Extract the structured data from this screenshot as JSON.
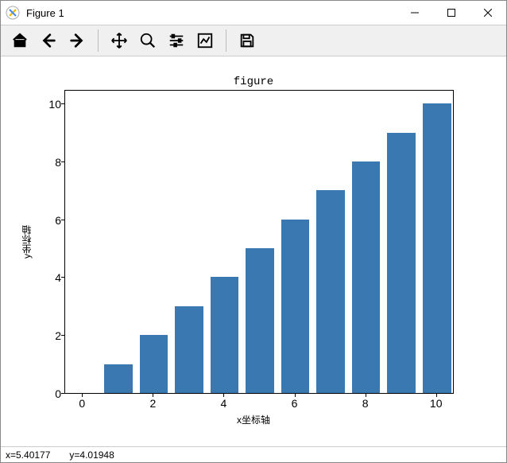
{
  "window": {
    "title": "Figure 1"
  },
  "toolbar": {
    "home": "home-icon",
    "back": "back-icon",
    "forward": "forward-icon",
    "pan": "pan-icon",
    "zoom": "zoom-icon",
    "config": "sliders-icon",
    "edit": "line-chart-icon",
    "save": "save-icon"
  },
  "statusbar": {
    "x": "x=5.40177",
    "y": "y=4.01948"
  },
  "chart_data": {
    "type": "bar",
    "title": "figure",
    "xlabel": "x坐标轴",
    "ylabel": "y坐标轴",
    "categories": [
      1,
      2,
      3,
      4,
      5,
      6,
      7,
      8,
      9,
      10
    ],
    "values": [
      1,
      2,
      3,
      4,
      5,
      6,
      7,
      8,
      9,
      10
    ],
    "xlim": [
      -0.5,
      10.5
    ],
    "ylim": [
      0,
      10.5
    ],
    "xticks": [
      0,
      2,
      4,
      6,
      8,
      10
    ],
    "yticks": [
      0,
      2,
      4,
      6,
      8,
      10
    ]
  }
}
